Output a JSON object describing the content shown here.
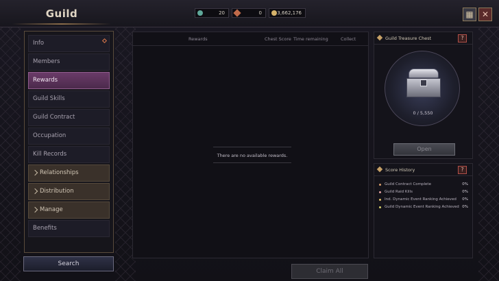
{
  "header": {
    "title": "Guild",
    "currencies": [
      {
        "icon": "gem-icon",
        "value": "20",
        "color": "#5fa89a"
      },
      {
        "icon": "arrow-icon",
        "value": "0",
        "color": "#c06a4a"
      },
      {
        "icon": "coin-icon",
        "value": "3,662,176",
        "color": "#d6b36b"
      }
    ]
  },
  "sidebar": {
    "items": [
      {
        "label": "Info"
      },
      {
        "label": "Members"
      },
      {
        "label": "Rewards"
      },
      {
        "label": "Guild Skills"
      },
      {
        "label": "Guild Contract"
      },
      {
        "label": "Occupation"
      },
      {
        "label": "Kill Records"
      },
      {
        "label": "Relationships"
      },
      {
        "label": "Distribution"
      },
      {
        "label": "Manage"
      },
      {
        "label": "Benefits"
      }
    ],
    "search_label": "Search"
  },
  "rewards": {
    "columns": [
      "Rewards",
      "Chest Score",
      "Time remaining",
      "Collect"
    ],
    "empty_message": "There are no available rewards.",
    "claim_all_label": "Claim All"
  },
  "chest": {
    "title": "Guild Treasure Chest",
    "help": "?",
    "progress": "0 / 5,550",
    "progress_fraction": 0,
    "open_label": "Open"
  },
  "score_history": {
    "title": "Score History",
    "help": "?",
    "rows": [
      {
        "label": "Guild Contract Complete",
        "value": "0%",
        "color": "#d89b6a"
      },
      {
        "label": "Guild Raid Kills",
        "value": "0%",
        "color": "#e0a0a0"
      },
      {
        "label": "Ind. Dynamic Event Ranking Achieved",
        "value": "0%",
        "color": "#e6c36a"
      },
      {
        "label": "Guild Dynamic Event Ranking Achieved",
        "value": "0%",
        "color": "#d6d06a"
      }
    ]
  }
}
